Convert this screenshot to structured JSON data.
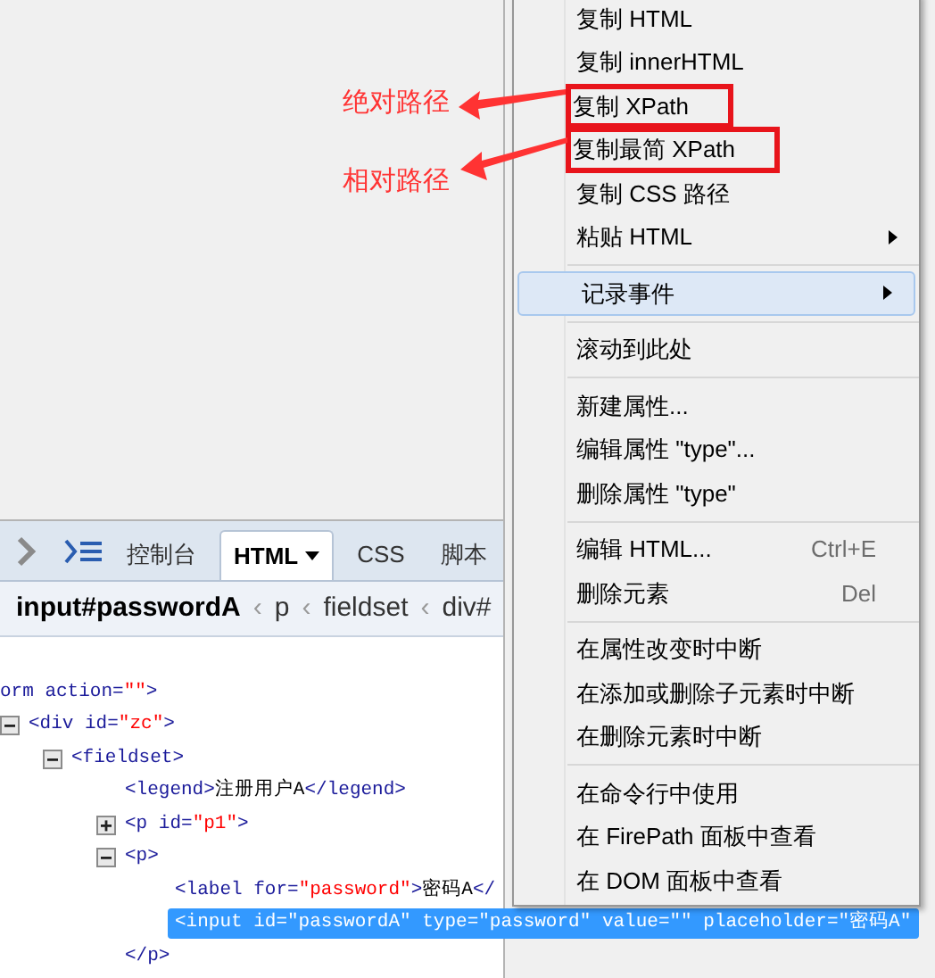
{
  "annotations": [
    {
      "label": "绝对路径"
    },
    {
      "label": "相对路径"
    }
  ],
  "toolbar": {
    "tabs": [
      {
        "label": "控制台",
        "selected": false,
        "dropdown": false
      },
      {
        "label": "HTML",
        "selected": true,
        "dropdown": true
      },
      {
        "label": "CSS",
        "selected": false,
        "dropdown": false
      },
      {
        "label": "脚本",
        "selected": false,
        "dropdown": false
      }
    ]
  },
  "breadcrumbs": [
    {
      "label": "input#passwordA",
      "selected": true
    },
    {
      "label": "p",
      "selected": false,
      "separator": "‹"
    },
    {
      "label": "fieldset",
      "selected": false,
      "separator": "‹"
    },
    {
      "label": "div#",
      "selected": false,
      "separator": "‹"
    }
  ],
  "html_tree": [
    {
      "selected": false,
      "segments": [
        {
          "kind": "tag",
          "text": "orm action="
        },
        {
          "kind": "value",
          "text": "\"\""
        },
        {
          "kind": "tag",
          "text": ">"
        }
      ],
      "children": [
        {
          "expanded": true,
          "selected": false,
          "segments": [
            {
              "kind": "tag",
              "text": "<div id="
            },
            {
              "kind": "value",
              "text": "\"zc\""
            },
            {
              "kind": "tag",
              "text": ">"
            }
          ],
          "children": [
            {
              "expanded": true,
              "selected": false,
              "segments": [
                {
                  "kind": "tag",
                  "text": "<fieldset>"
                }
              ],
              "children": [
                {
                  "selected": false,
                  "segments": [
                    {
                      "kind": "tag",
                      "text": "<legend>"
                    },
                    {
                      "kind": "text",
                      "text": "注册用户A"
                    },
                    {
                      "kind": "tag",
                      "text": "</legend>"
                    }
                  ]
                },
                {
                  "expanded": false,
                  "selected": false,
                  "segments": [
                    {
                      "kind": "tag",
                      "text": "<p id="
                    },
                    {
                      "kind": "value",
                      "text": "\"p1\""
                    },
                    {
                      "kind": "tag",
                      "text": ">"
                    }
                  ]
                },
                {
                  "expanded": true,
                  "selected": false,
                  "segments": [
                    {
                      "kind": "tag",
                      "text": "<p>"
                    }
                  ],
                  "children": [
                    {
                      "selected": false,
                      "segments": [
                        {
                          "kind": "tag",
                          "text": "<label for="
                        },
                        {
                          "kind": "value",
                          "text": "\"password\""
                        },
                        {
                          "kind": "tag",
                          "text": ">"
                        },
                        {
                          "kind": "text",
                          "text": "密码A"
                        },
                        {
                          "kind": "tag",
                          "text": "</"
                        }
                      ]
                    },
                    {
                      "selected": true,
                      "segments": [
                        {
                          "kind": "tag",
                          "text": "<input id=\"passwordA\" type=\"password\" value=\"\" placeholder=\"密码A\""
                        }
                      ]
                    }
                  ]
                },
                {
                  "selected": false,
                  "segments": [
                    {
                      "kind": "tag",
                      "text": "</p>"
                    }
                  ]
                }
              ]
            }
          ]
        }
      ]
    }
  ],
  "context_menu": [
    {
      "kind": "item",
      "label": "复制 HTML",
      "highlighted": false,
      "outlined": false,
      "submenu": false
    },
    {
      "kind": "item",
      "label": "复制 innerHTML",
      "highlighted": false,
      "outlined": false,
      "submenu": false
    },
    {
      "kind": "item",
      "label": "复制 XPath",
      "highlighted": false,
      "outlined": true,
      "submenu": false
    },
    {
      "kind": "item",
      "label": "复制最简 XPath",
      "highlighted": false,
      "outlined": true,
      "submenu": false
    },
    {
      "kind": "item",
      "label": "复制 CSS 路径",
      "highlighted": false,
      "outlined": false,
      "submenu": false
    },
    {
      "kind": "item",
      "label": "粘贴 HTML",
      "highlighted": false,
      "outlined": false,
      "submenu": true
    },
    {
      "kind": "separator"
    },
    {
      "kind": "item",
      "label": "记录事件",
      "highlighted": true,
      "outlined": false,
      "submenu": true
    },
    {
      "kind": "separator"
    },
    {
      "kind": "item",
      "label": "滚动到此处",
      "highlighted": false,
      "outlined": false,
      "submenu": false
    },
    {
      "kind": "separator"
    },
    {
      "kind": "item",
      "label": "新建属性...",
      "highlighted": false,
      "outlined": false,
      "submenu": false
    },
    {
      "kind": "item",
      "label": "编辑属性 \"type\"...",
      "highlighted": false,
      "outlined": false,
      "submenu": false
    },
    {
      "kind": "item",
      "label": "删除属性 \"type\"",
      "highlighted": false,
      "outlined": false,
      "submenu": false
    },
    {
      "kind": "separator"
    },
    {
      "kind": "item",
      "label": "编辑 HTML...",
      "shortcut": "Ctrl+E",
      "highlighted": false,
      "outlined": false,
      "submenu": false
    },
    {
      "kind": "item",
      "label": "删除元素",
      "shortcut": "Del",
      "highlighted": false,
      "outlined": false,
      "submenu": false
    },
    {
      "kind": "separator"
    },
    {
      "kind": "item",
      "label": "在属性改变时中断",
      "highlighted": false,
      "outlined": false,
      "submenu": false
    },
    {
      "kind": "item",
      "label": "在添加或删除子元素时中断",
      "highlighted": false,
      "outlined": false,
      "submenu": false
    },
    {
      "kind": "item",
      "label": "在删除元素时中断",
      "highlighted": false,
      "outlined": false,
      "submenu": false
    },
    {
      "kind": "separator"
    },
    {
      "kind": "item",
      "label": "在命令行中使用",
      "highlighted": false,
      "outlined": false,
      "submenu": false
    },
    {
      "kind": "item",
      "label": "在 FirePath 面板中查看",
      "highlighted": false,
      "outlined": false,
      "submenu": false
    },
    {
      "kind": "item",
      "label": "在 DOM 面板中查看",
      "highlighted": false,
      "outlined": false,
      "submenu": false
    }
  ]
}
